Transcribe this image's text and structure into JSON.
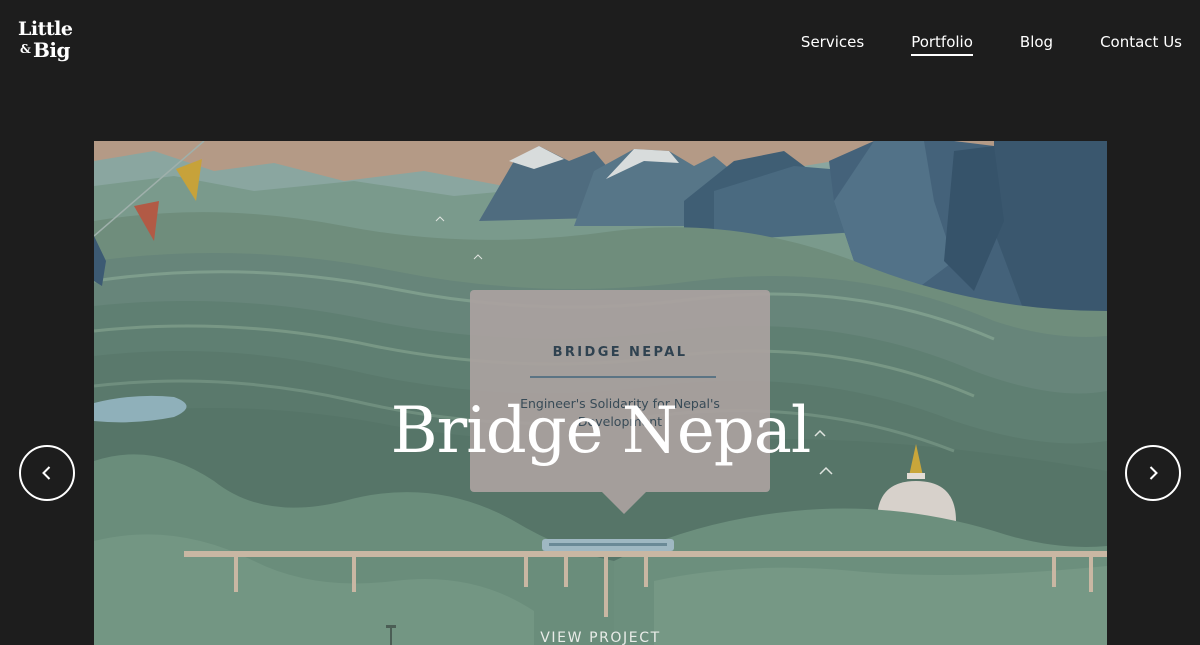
{
  "header": {
    "logo": {
      "line1": "Little",
      "ampersand": "&",
      "line2": "Big"
    },
    "nav": [
      {
        "label": "Services",
        "active": false
      },
      {
        "label": "Portfolio",
        "active": true
      },
      {
        "label": "Blog",
        "active": false
      },
      {
        "label": "Contact Us",
        "active": false
      }
    ]
  },
  "hero": {
    "card": {
      "title": "BRIDGE NEPAL",
      "subtitle": "Engineer's Solidarity for Nepal's Development"
    },
    "title": "Bridge Nepal",
    "cta": "VIEW PROJECT",
    "prev_icon": "chevron-left-icon",
    "next_icon": "chevron-right-icon"
  },
  "colors": {
    "background": "#1d1d1d",
    "text": "#ffffff",
    "card": "#aaa2a0",
    "card_text": "#2f4250"
  }
}
